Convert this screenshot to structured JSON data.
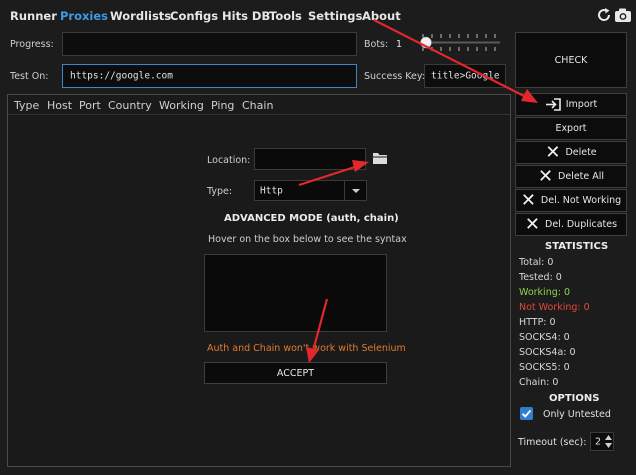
{
  "menu": {
    "items": [
      "Runner",
      "Proxies",
      "Wordlists",
      "Configs",
      "Hits DB",
      "Tools",
      "Settings",
      "About"
    ],
    "active_index": 1
  },
  "progress": {
    "label": "Progress:",
    "value": ""
  },
  "bots": {
    "label": "Bots:",
    "value": "1"
  },
  "test_on": {
    "label": "Test On:",
    "value": "https://google.com"
  },
  "success_key": {
    "label": "Success Key:",
    "value": "title>Google"
  },
  "check_button": "CHECK",
  "columns": [
    "Type",
    "Host",
    "Port",
    "Country",
    "Working",
    "Ping",
    "Chain"
  ],
  "import_dialog": {
    "location_label": "Location:",
    "location_value": "",
    "type_label": "Type:",
    "type_value": "Http",
    "advanced_title": "ADVANCED MODE (auth, chain)",
    "hover_hint": "Hover on the box below to see the syntax",
    "advanced_value": "",
    "warning": "Auth and Chain won't work with Selenium",
    "accept_label": "ACCEPT"
  },
  "side_buttons": {
    "import": "Import",
    "export": "Export",
    "delete": "Delete",
    "delete_all": "Delete All",
    "del_not_working": "Del. Not Working",
    "del_duplicates": "Del. Duplicates"
  },
  "statistics": {
    "title": "STATISTICS",
    "total": "Total:  0",
    "tested": "Tested:  0",
    "working": "Working:  0",
    "not_working": "Not Working:  0",
    "http": "HTTP:  0",
    "socks4": "SOCKS4:  0",
    "socks4a": "SOCKS4a:  0",
    "socks5": "SOCKS5:  0",
    "chain": "Chain:  0"
  },
  "options": {
    "title": "OPTIONS",
    "only_untested_label": "Only Untested",
    "only_untested_checked": true,
    "timeout_label": "Timeout (sec):",
    "timeout_value": "2"
  },
  "colors": {
    "accent": "#3d9ae8",
    "working": "#8fd14f",
    "not_working": "#e04a3a",
    "warning": "#e07b2e",
    "annotation_arrow": "#e3282d"
  },
  "icons": [
    "refresh-icon",
    "camera-icon",
    "import-icon",
    "folder-icon",
    "x-icon",
    "checkmark-icon",
    "dropdown-arrow-icon",
    "spinner-up-icon",
    "spinner-down-icon"
  ]
}
